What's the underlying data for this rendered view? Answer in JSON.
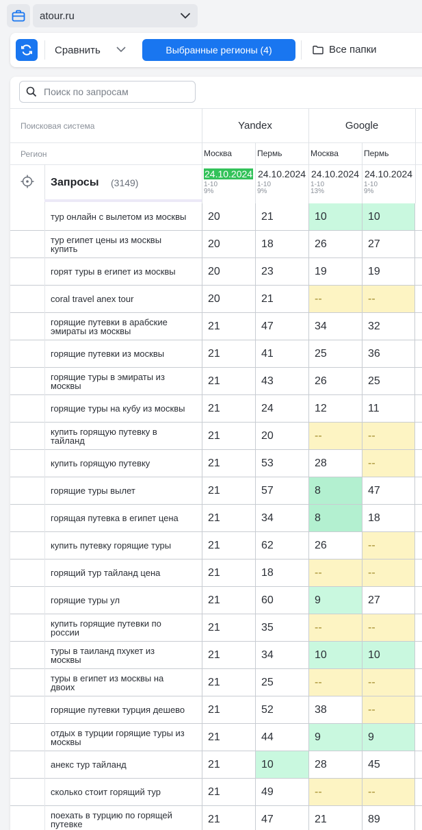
{
  "site": {
    "value": "atour.ru"
  },
  "toolbar": {
    "compare_label": "Сравнить",
    "regions_button": "Выбранные регионы  (4)",
    "folders_label": "Все папки"
  },
  "search": {
    "placeholder": "Поиск по запросам"
  },
  "table": {
    "engine_label": "Поисковая система",
    "region_label": "Регион",
    "engines": [
      "Yandex",
      "Google"
    ],
    "regions": [
      "Москва",
      "Пермь",
      "Москва",
      "Пермь"
    ],
    "queries_title": "Запросы",
    "queries_count": "(3149)",
    "columns": [
      {
        "date": "24.10.2024",
        "range": "1-10",
        "pct": "9%",
        "highlight": true
      },
      {
        "date": "24.10.2024",
        "range": "1-10",
        "pct": "9%",
        "highlight": false
      },
      {
        "date": "24.10.2024",
        "range": "1-10",
        "pct": "13%",
        "highlight": false
      },
      {
        "date": "24.10.2024",
        "range": "1-10",
        "pct": "9%",
        "highlight": false
      }
    ],
    "rows": [
      {
        "query": "тур онлайн с вылетом из москвы",
        "values": [
          "20",
          "21",
          "10",
          "10"
        ]
      },
      {
        "query": "тур египет цены из москвы купить",
        "values": [
          "20",
          "18",
          "26",
          "27"
        ]
      },
      {
        "query": "горят туры в египет из москвы",
        "values": [
          "20",
          "23",
          "19",
          "19"
        ]
      },
      {
        "query": "coral travel anex tour",
        "values": [
          "20",
          "21",
          "--",
          "--"
        ]
      },
      {
        "query": "горящие путевки в арабские эмираты из москвы",
        "values": [
          "21",
          "47",
          "34",
          "32"
        ]
      },
      {
        "query": "горящие путевки из москвы",
        "values": [
          "21",
          "41",
          "25",
          "36"
        ]
      },
      {
        "query": "горящие туры в эмираты из москвы",
        "values": [
          "21",
          "43",
          "26",
          "25"
        ]
      },
      {
        "query": "горящие туры на кубу из москвы",
        "values": [
          "21",
          "24",
          "12",
          "11"
        ]
      },
      {
        "query": "купить горящую путевку в тайланд",
        "values": [
          "21",
          "20",
          "--",
          "--"
        ]
      },
      {
        "query": "купить горящую путевку",
        "values": [
          "21",
          "53",
          "28",
          "--"
        ]
      },
      {
        "query": "горящие туры вылет",
        "values": [
          "21",
          "57",
          "8",
          "47"
        ]
      },
      {
        "query": "горящая путевка в египет цена",
        "values": [
          "21",
          "34",
          "8",
          "18"
        ]
      },
      {
        "query": "купить путевку горящие туры",
        "values": [
          "21",
          "62",
          "26",
          "--"
        ]
      },
      {
        "query": "горящий тур тайланд цена",
        "values": [
          "21",
          "18",
          "--",
          "--"
        ]
      },
      {
        "query": "горящие туры ул",
        "values": [
          "21",
          "60",
          "9",
          "27"
        ]
      },
      {
        "query": "купить горящие путевки по россии",
        "values": [
          "21",
          "35",
          "--",
          "--"
        ]
      },
      {
        "query": "туры в таиланд пхукет из москвы",
        "values": [
          "21",
          "34",
          "10",
          "10"
        ]
      },
      {
        "query": "туры в египет из москвы на двоих",
        "values": [
          "21",
          "25",
          "--",
          "--"
        ]
      },
      {
        "query": "горящие путевки турция дешево",
        "values": [
          "21",
          "52",
          "38",
          "--"
        ]
      },
      {
        "query": "отдых в турции горящие туры из москвы",
        "values": [
          "21",
          "44",
          "9",
          "9"
        ]
      },
      {
        "query": "анекс тур тайланд",
        "values": [
          "21",
          "10",
          "28",
          "45"
        ]
      },
      {
        "query": "сколько стоит горящий тур",
        "values": [
          "21",
          "49",
          "--",
          "--"
        ]
      },
      {
        "query": "поехать в турцию по горящей путевке",
        "values": [
          "21",
          "47",
          "21",
          "89"
        ]
      }
    ]
  },
  "colors": {
    "accent": "#1976f0",
    "top10": "#c9f8df",
    "top3": "#b3f0d0",
    "not_found": "#fdf4c3",
    "date_highlight": "#33c25a"
  }
}
